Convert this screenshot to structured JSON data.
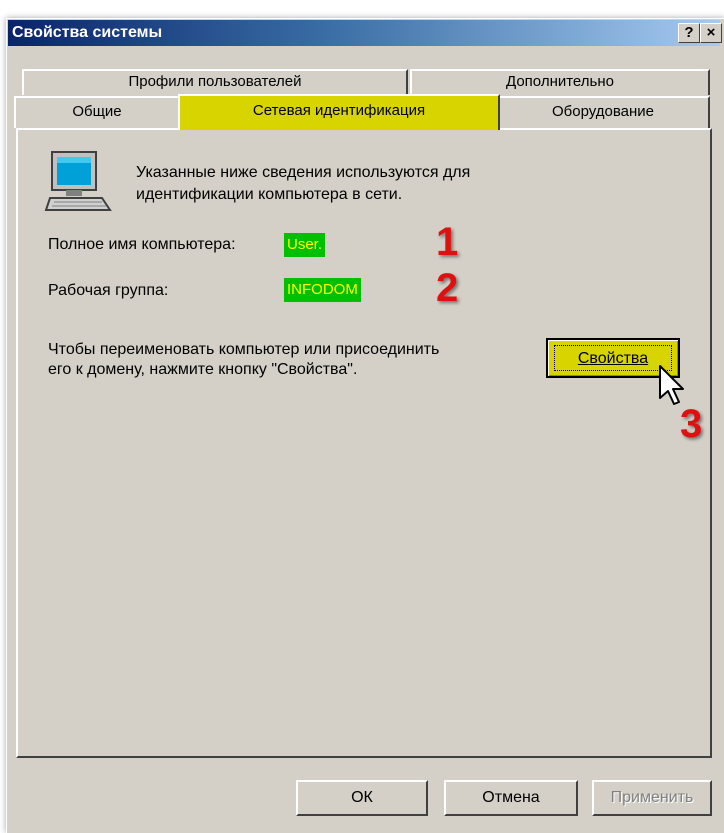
{
  "window": {
    "title": "Свойства системы",
    "help_glyph": "?",
    "close_glyph": "×"
  },
  "tabs": {
    "row1": [
      {
        "label": "Профили пользователей"
      },
      {
        "label": "Дополнительно"
      }
    ],
    "row2": [
      {
        "label": "Общие"
      },
      {
        "label": "Сетевая идентификация",
        "active": true
      },
      {
        "label": "Оборудование"
      }
    ]
  },
  "panel": {
    "intro_line1": "Указанные ниже сведения используются для",
    "intro_line2": "идентификации компьютера в сети.",
    "computer_name_label": "Полное имя компьютера:",
    "computer_name_value": "User.",
    "workgroup_label": "Рабочая группа:",
    "workgroup_value": "INFODOM",
    "rename_line1": "Чтобы переименовать компьютер или присоединить",
    "rename_line2": "его к домену, нажмите кнопку \"Свойства\".",
    "properties_button": "Свойства"
  },
  "annotations": [
    "1",
    "2",
    "3"
  ],
  "buttons": {
    "ok": "ОК",
    "cancel": "Отмена",
    "apply": "Применить"
  },
  "colors": {
    "highlight_tab": "#d7d400",
    "value_bg": "#00c000",
    "value_text": "#ffff00",
    "annotation": "#e11010"
  }
}
